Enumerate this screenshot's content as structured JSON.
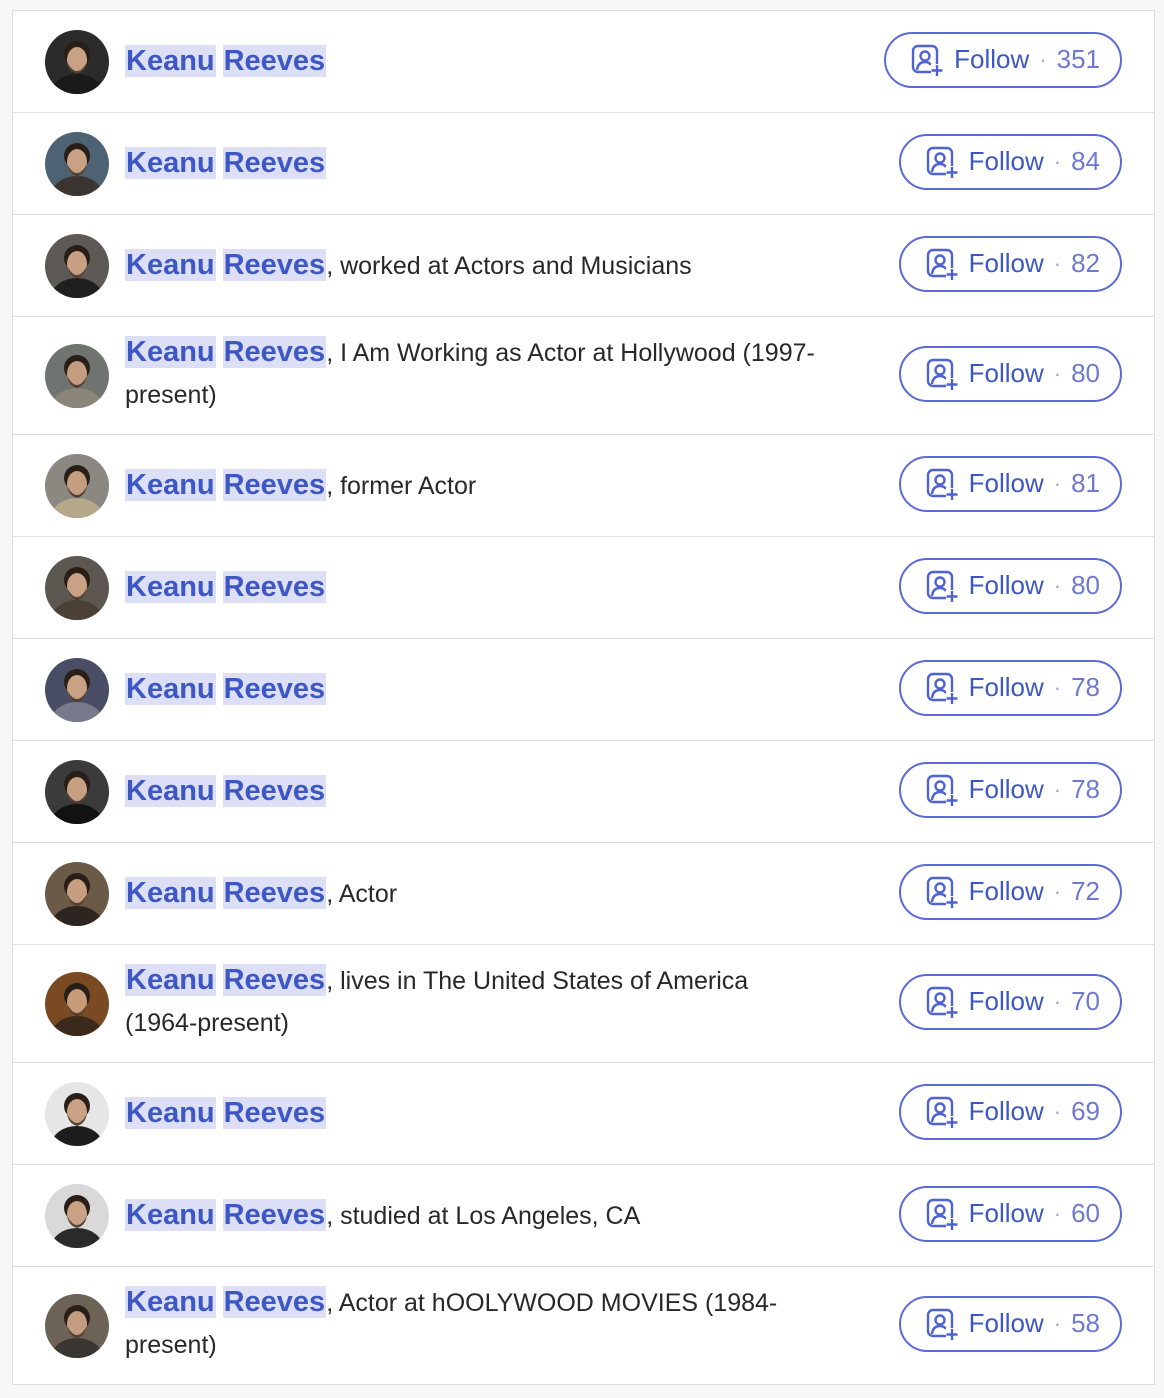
{
  "rows": [
    {
      "first": "Keanu",
      "last": "Reeves",
      "desc": "",
      "follow": "Follow",
      "count": "351",
      "avatar": {
        "bg": "#2b2b2b",
        "skin": "#c9a184",
        "shirt": "#1a1a1a"
      }
    },
    {
      "first": "Keanu",
      "last": "Reeves",
      "desc": "",
      "follow": "Follow",
      "count": "84",
      "avatar": {
        "bg": "#4d6273",
        "skin": "#c9a184",
        "shirt": "#3a3530"
      }
    },
    {
      "first": "Keanu",
      "last": "Reeves",
      "desc": ", worked at Actors and Musicians",
      "follow": "Follow",
      "count": "82",
      "avatar": {
        "bg": "#5d5a55",
        "skin": "#c8a083",
        "shirt": "#1f1f1f"
      }
    },
    {
      "first": "Keanu",
      "last": "Reeves",
      "desc": ", I Am Working as Actor at Hollywood (1997-present)",
      "follow": "Follow",
      "count": "80",
      "avatar": {
        "bg": "#6f7470",
        "skin": "#c49c80",
        "shirt": "#8b8478"
      }
    },
    {
      "first": "Keanu",
      "last": "Reeves",
      "desc": ", former Actor",
      "follow": "Follow",
      "count": "81",
      "avatar": {
        "bg": "#8a8880",
        "skin": "#c59d81",
        "shirt": "#b8a88a"
      }
    },
    {
      "first": "Keanu",
      "last": "Reeves",
      "desc": "",
      "follow": "Follow",
      "count": "80",
      "avatar": {
        "bg": "#5c5750",
        "skin": "#c9a184",
        "shirt": "#4b4036"
      }
    },
    {
      "first": "Keanu",
      "last": "Reeves",
      "desc": "",
      "follow": "Follow",
      "count": "78",
      "avatar": {
        "bg": "#4a4d66",
        "skin": "#c9a184",
        "shirt": "#777a8a"
      }
    },
    {
      "first": "Keanu",
      "last": "Reeves",
      "desc": "",
      "follow": "Follow",
      "count": "78",
      "avatar": {
        "bg": "#3b3b3b",
        "skin": "#c7a083",
        "shirt": "#121212"
      }
    },
    {
      "first": "Keanu",
      "last": "Reeves",
      "desc": ", Actor",
      "follow": "Follow",
      "count": "72",
      "avatar": {
        "bg": "#6b5a47",
        "skin": "#c89e80",
        "shirt": "#2c2520"
      }
    },
    {
      "first": "Keanu",
      "last": "Reeves",
      "desc": ", lives in The United States of America (1964-present)",
      "follow": "Follow",
      "count": "70",
      "avatar": {
        "bg": "#7a4b22",
        "skin": "#c99a78",
        "shirt": "#3b2a1c"
      }
    },
    {
      "first": "Keanu",
      "last": "Reeves",
      "desc": "",
      "follow": "Follow",
      "count": "69",
      "avatar": {
        "bg": "#e6e6e6",
        "skin": "#c9a184",
        "shirt": "#1c1c1c"
      }
    },
    {
      "first": "Keanu",
      "last": "Reeves",
      "desc": ", studied at Los Angeles, CA",
      "follow": "Follow",
      "count": "60",
      "avatar": {
        "bg": "#d9d9d9",
        "skin": "#c9a184",
        "shirt": "#2a2a2a"
      }
    },
    {
      "first": "Keanu",
      "last": "Reeves",
      "desc": ", Actor at hOOLYWOOD MOVIES (1984-present)",
      "follow": "Follow",
      "count": "58",
      "avatar": {
        "bg": "#6c6356",
        "skin": "#c49d80",
        "shirt": "#3a3632"
      }
    }
  ]
}
